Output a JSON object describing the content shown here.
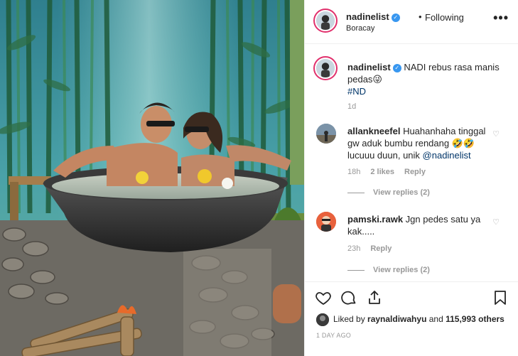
{
  "post": {
    "header": {
      "username": "nadinelist",
      "separator": "•",
      "follow_status": "Following",
      "location": "Boracay"
    },
    "caption": {
      "username": "nadinelist",
      "text": "NADI rebus rasa manis pedas",
      "emoji": "😜",
      "hashtag": "#ND",
      "time": "1d"
    },
    "comments": [
      {
        "username": "allankneefel",
        "text": "Huahanhaha tinggal gw aduk bumbu rendang 🤣🤣 lucuuu duun, unik ",
        "mention": "@nadinelist",
        "time": "18h",
        "likes": "2 likes",
        "reply": "Reply",
        "view_replies": "View replies (2)"
      },
      {
        "username": "pamski.rawk",
        "text": "Jgn pedes satu ya kak.....",
        "mention": "",
        "time": "23h",
        "likes": "",
        "reply": "Reply",
        "view_replies": "View replies (2)"
      }
    ],
    "likes": {
      "prefix": "Liked by ",
      "liker": "raynaldiwahyu",
      "middle": " and ",
      "count": "115,993 others"
    },
    "date": "1 DAY AGO"
  },
  "colors": {
    "verified": "#3897f0",
    "link": "#003569",
    "muted": "#999999",
    "story_ring": "#e1306c"
  },
  "icons": [
    "more-options-icon",
    "verified-badge-icon",
    "heart-icon",
    "comment-icon",
    "share-icon",
    "bookmark-icon"
  ]
}
